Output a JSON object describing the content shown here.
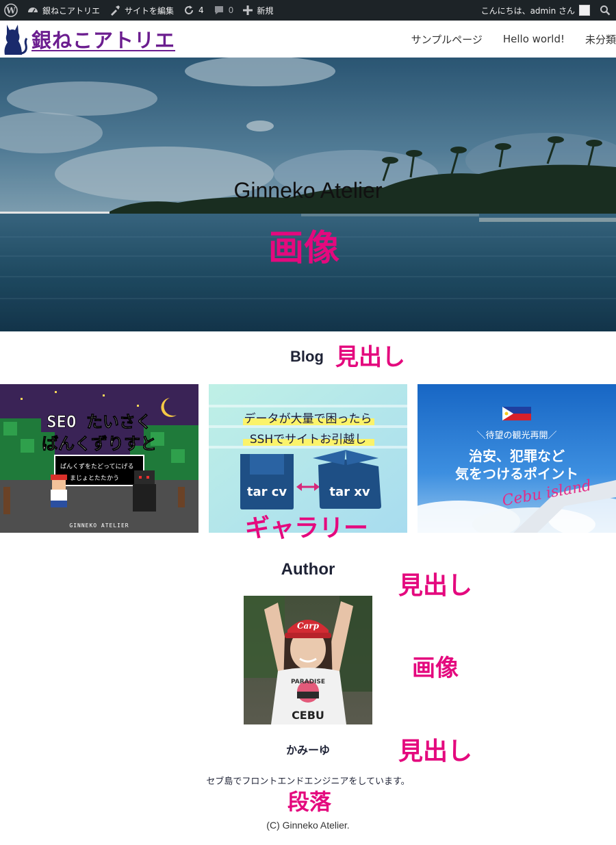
{
  "adminbar": {
    "site_name": "銀ねこアトリエ",
    "customize": "サイトを編集",
    "updates_count": "4",
    "comments_count": "0",
    "new_label": "新規",
    "greeting": "こんにちは、admin さん"
  },
  "header": {
    "site_title": "銀ねこアトリエ",
    "nav": [
      "サンプルページ",
      "Hello world!",
      "未分類"
    ]
  },
  "hero": {
    "title": "Ginneko Atelier",
    "annotation": "画像"
  },
  "blog": {
    "heading": "Blog",
    "annotation": "見出し"
  },
  "gallery": {
    "annotation": "ギャラリー",
    "items": [
      {
        "line1": "SEO たいさく",
        "line2": "ばんくずりすと",
        "sub1": "ぱんくずをたどってにげる",
        "sub2": "まじょとたたかう",
        "brand": "GINNEKO ATELIER"
      },
      {
        "line1": "データが大量で困ったら",
        "line2": "SSHでサイトお引越し",
        "box_left": "tar cv",
        "box_right": "tar xv"
      },
      {
        "top": "＼待望の観光再開／",
        "line1": "治安、犯罪など",
        "line2": "気をつけるポイント",
        "script": "Cebu island"
      }
    ]
  },
  "author": {
    "heading": "Author",
    "heading_annotation": "見出し",
    "image_annotation": "画像",
    "name": "かみーゆ",
    "name_annotation": "見出し",
    "description": "セブ島でフロントエンドエンジニアをしています。",
    "description_annotation": "段落",
    "cap_text": "Carp",
    "shirt_text": "PARADISE",
    "shirt_text2": "CEBU"
  },
  "footer": {
    "copyright": "(C) Ginneko Atelier."
  }
}
